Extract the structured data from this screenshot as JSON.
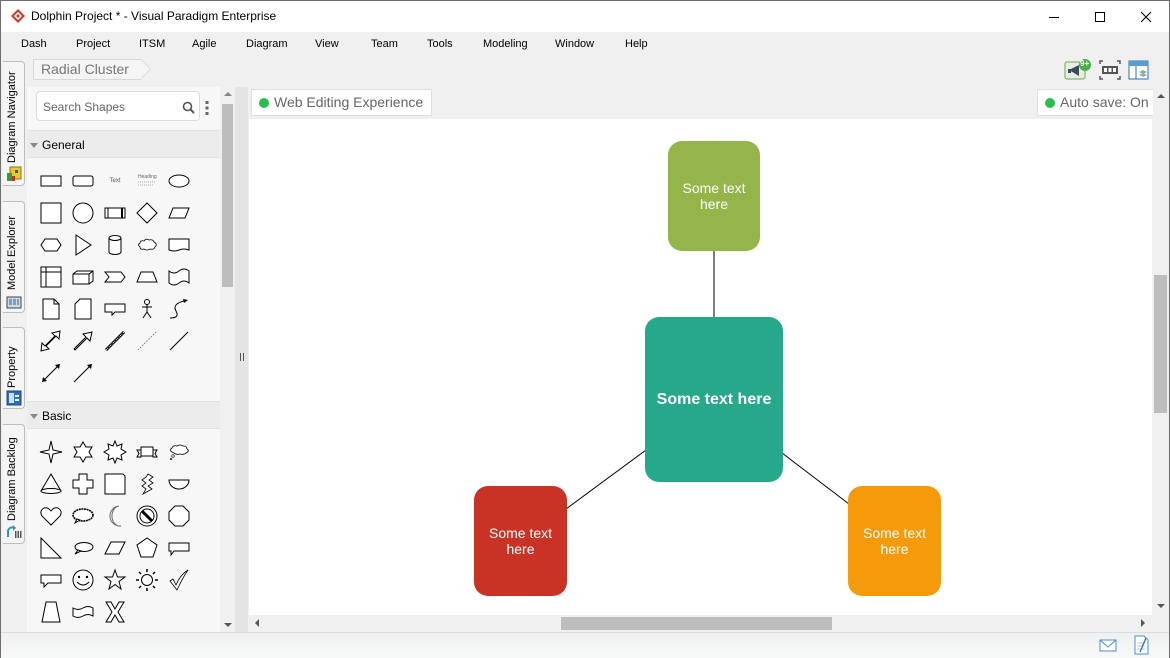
{
  "window": {
    "title": "Dolphin Project * - Visual Paradigm Enterprise",
    "controls": [
      "minimize",
      "maximize",
      "close"
    ]
  },
  "menu": {
    "items": [
      "Dash",
      "Project",
      "ITSM",
      "Agile",
      "Diagram",
      "View",
      "Team",
      "Tools",
      "Modeling",
      "Window",
      "Help"
    ]
  },
  "toolbar": {
    "breadcrumb": "Radial Cluster",
    "notification_badge": "9+",
    "icons": [
      "announcement-icon",
      "fit-diagram-icon",
      "layers-panel-icon"
    ]
  },
  "side_tabs": [
    {
      "label": "Diagram Navigator",
      "icon": "navigator-icon"
    },
    {
      "label": "Model Explorer",
      "icon": "model-explorer-icon"
    },
    {
      "label": "Property",
      "icon": "property-icon"
    },
    {
      "label": "Diagram Backlog",
      "icon": "backlog-icon"
    }
  ],
  "palette": {
    "search_placeholder": "Search Shapes",
    "sections": [
      {
        "label": "General",
        "shapes": [
          "rectangle",
          "rounded-rectangle",
          "text",
          "heading",
          "ellipse",
          "square",
          "circle",
          "process",
          "diamond",
          "parallelogram",
          "hexagon",
          "triangle",
          "cylinder",
          "cloud",
          "document",
          "internal-storage",
          "cube",
          "chevron",
          "trapezoid",
          "tape",
          "note",
          "card",
          "callout",
          "actor",
          "curved-arrow",
          "double-block-arrow",
          "block-arrow",
          "double-line",
          "dashed-line",
          "line",
          "bidirectional-arrow",
          "arrow"
        ],
        "text_sample": "Text",
        "heading_sample": "Heading"
      },
      {
        "label": "Basic",
        "shapes": [
          "4-point-star",
          "6-point-star",
          "8-point-star",
          "banner",
          "thought-bubble",
          "cone",
          "cross",
          "folded-corner",
          "lightning",
          "half-circle",
          "heart",
          "loud-callout",
          "moon",
          "no-symbol",
          "octagon",
          "right-triangle",
          "oval-callout",
          "parallelogram",
          "pentagon",
          "rect-callout",
          "rect-callout-left",
          "smiley",
          "5-point-star",
          "sun",
          "check",
          "trapezoid",
          "wave",
          "x-shape"
        ]
      }
    ]
  },
  "canvas": {
    "web_editing_label": "Web Editing Experience",
    "auto_save_label": "Auto save: On",
    "status_dot_color": "#2dbd4e",
    "nodes": [
      {
        "id": "center",
        "text": "Some text here",
        "color": "#26a98b",
        "bold": true
      },
      {
        "id": "top",
        "text": "Some text here",
        "color": "#93b54a",
        "bold": false
      },
      {
        "id": "bottom-left",
        "text": "Some text here",
        "color": "#c93325",
        "bold": false
      },
      {
        "id": "bottom-right",
        "text": "Some text here",
        "color": "#f59b0b",
        "bold": false
      }
    ],
    "edges": [
      {
        "from": "center",
        "to": "top"
      },
      {
        "from": "center",
        "to": "bottom-left"
      },
      {
        "from": "center",
        "to": "bottom-right"
      }
    ]
  },
  "statusbar": {
    "icons": [
      "mail-icon",
      "notes-icon"
    ]
  }
}
